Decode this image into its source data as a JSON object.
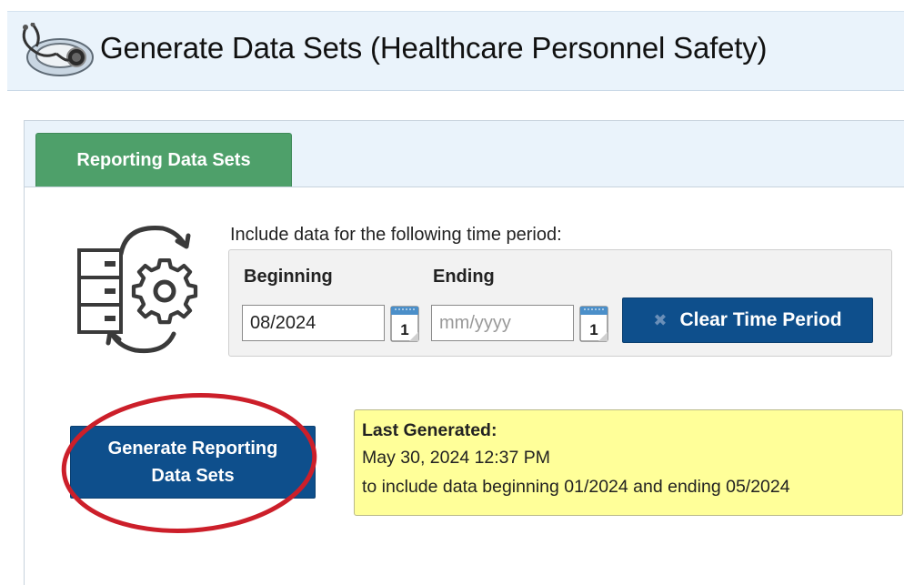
{
  "page": {
    "title": "Generate Data Sets (Healthcare Personnel Safety)",
    "icon": "stethoscope-icon"
  },
  "tabs": [
    {
      "label": "Reporting Data Sets",
      "active": true
    }
  ],
  "time_period": {
    "prompt": "Include data for the following time period:",
    "beginning_label": "Beginning",
    "beginning_value": "08/2024",
    "ending_label": "Ending",
    "ending_value": "",
    "ending_placeholder": "mm/yyyy",
    "calendar_day": "1",
    "clear_icon": "x-icon",
    "clear_label": "Clear Time Period"
  },
  "actions": {
    "generate_label_line1": "Generate Reporting",
    "generate_label_line2": "Data Sets",
    "generate_icon": "data-sync-gear-icon"
  },
  "last_generated": {
    "title": "Last Generated:",
    "datetime": "May 30, 2024 12:37 PM",
    "range_text": "to include data beginning 01/2024 and ending 05/2024"
  },
  "colors": {
    "header_bg": "#eaf3fb",
    "tab_green": "#4ea06a",
    "button_blue": "#0e4f8c",
    "notice_yellow": "#ffff99",
    "highlight_red": "#cc1f2a"
  }
}
